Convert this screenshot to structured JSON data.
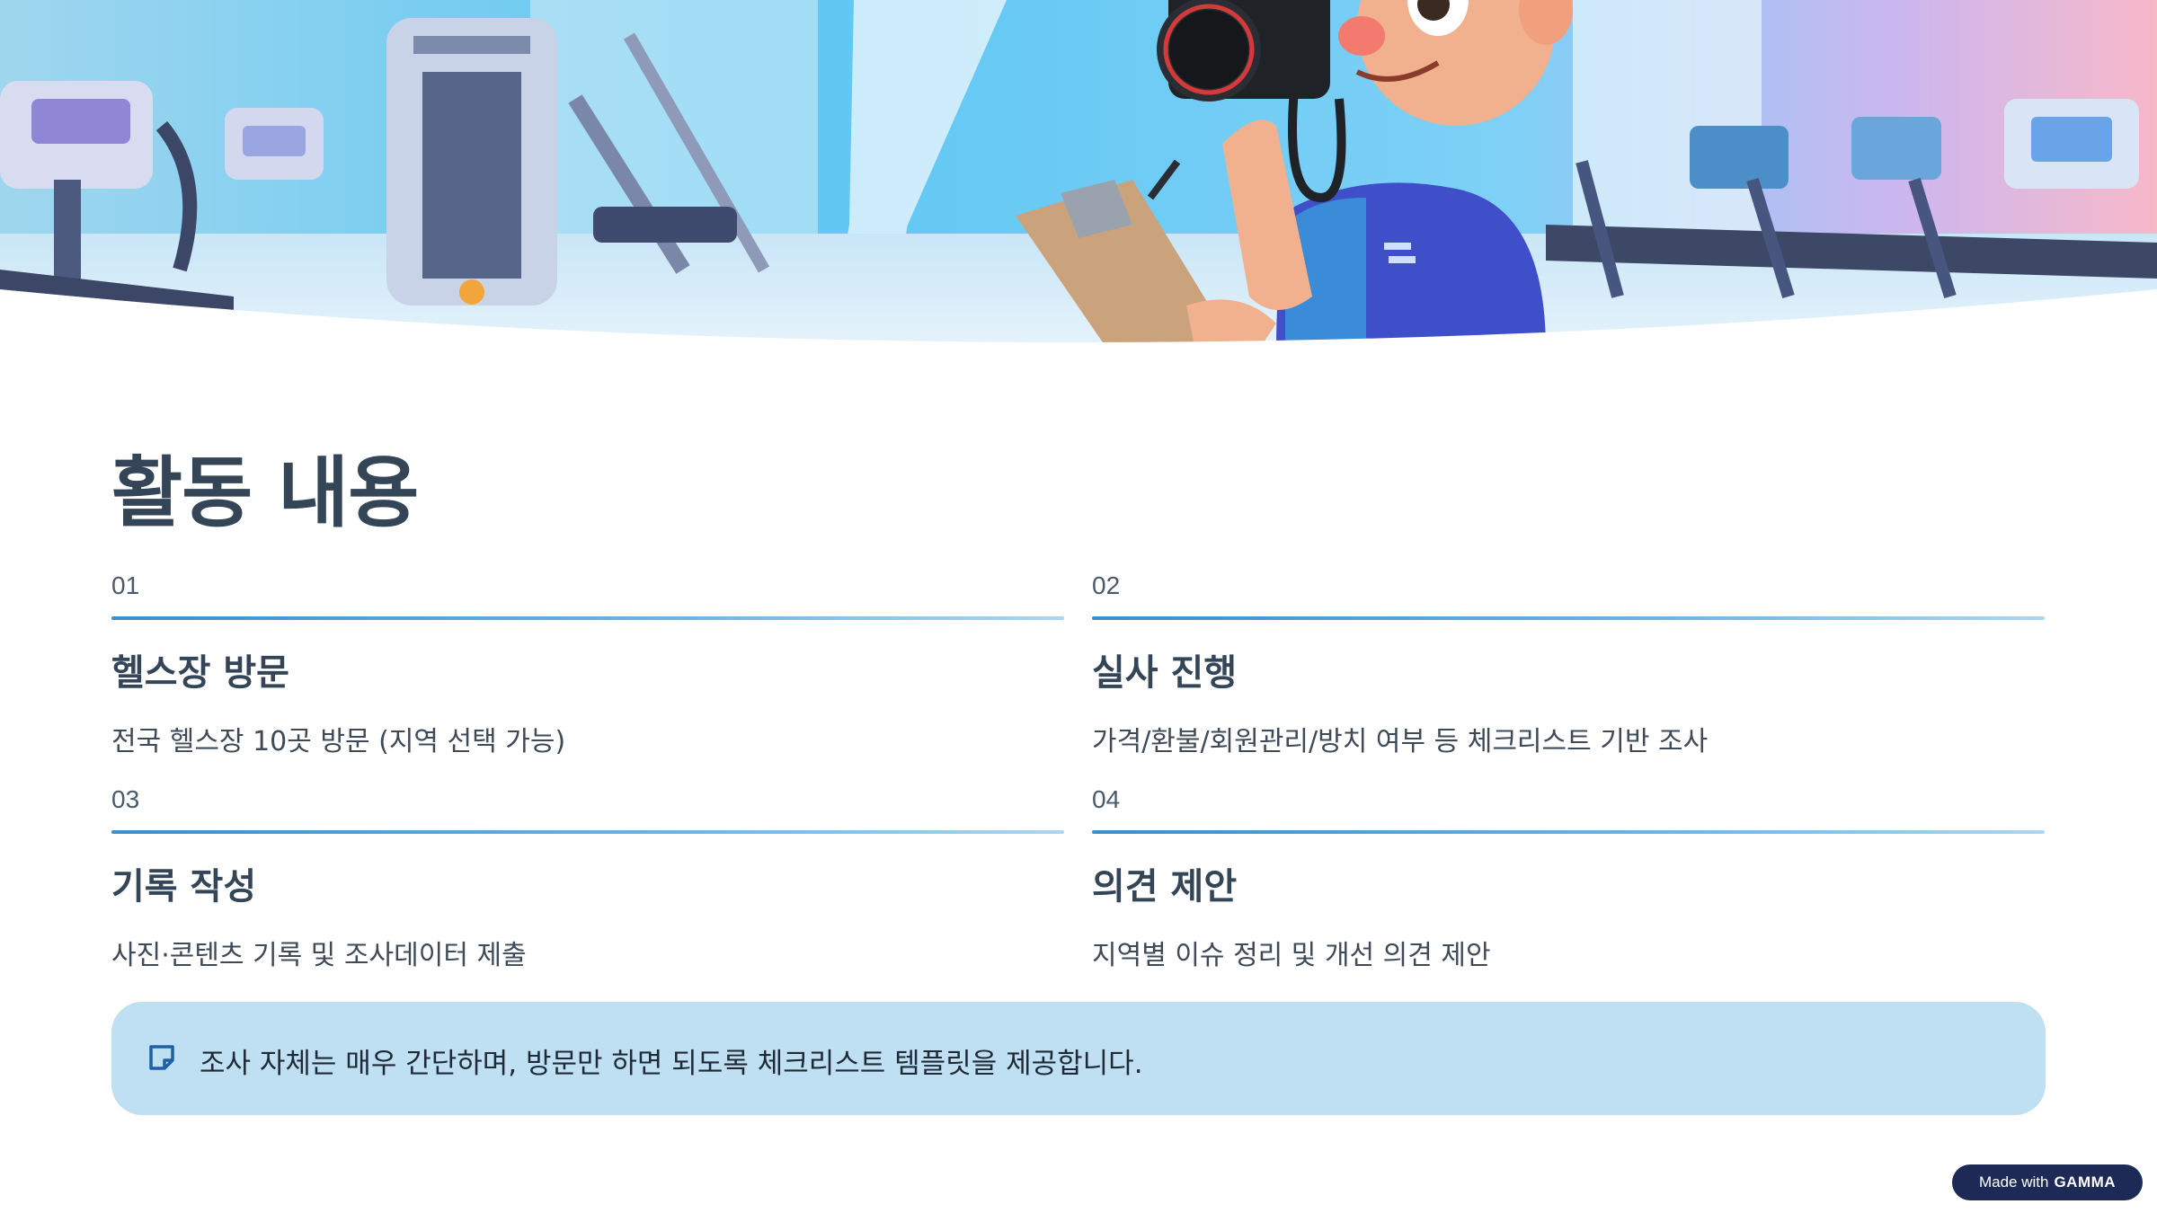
{
  "slide": {
    "title": "활동 내용",
    "items": [
      {
        "num": "01",
        "heading": "헬스장 방문",
        "description": "전국 헬스장 10곳 방문 (지역 선택 가능)"
      },
      {
        "num": "02",
        "heading": "실사 진행",
        "description": "가격/환불/회원관리/방치 여부 등 체크리스트 기반 조사"
      },
      {
        "num": "03",
        "heading": "기록 작성",
        "description": "사진·콘텐츠 기록 및 조사데이터 제출"
      },
      {
        "num": "04",
        "heading": "의견 제안",
        "description": "지역별 이슈 정리 및 개선 의견 제안"
      }
    ],
    "callout": {
      "icon": "note-icon",
      "text": "조사 자체는 매우 간단하며, 방문만 하면 되도록 체크리스트 템플릿을 제공합니다."
    }
  },
  "hero_image": {
    "description_icon": "gym-photographer-illustration"
  },
  "badge": {
    "prefix": "Made with",
    "brand": "GAMMA"
  },
  "colors": {
    "accent": "#3d8ec9",
    "callout_bg": "#bfe0f3",
    "badge_bg": "#1d2a55",
    "title": "#344558"
  }
}
